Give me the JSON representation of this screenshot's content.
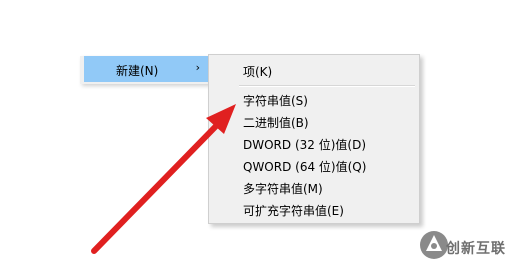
{
  "parent_menu": {
    "item_label": "新建(N)",
    "arrow": "›"
  },
  "submenu": {
    "items": [
      {
        "label": "项(K)"
      },
      {
        "label": "字符串值(S)"
      },
      {
        "label": "二进制值(B)"
      },
      {
        "label": "DWORD (32 位)值(D)"
      },
      {
        "label": "QWORD (64 位)值(Q)"
      },
      {
        "label": "多字符串值(M)"
      },
      {
        "label": "可扩充字符串值(E)"
      }
    ]
  },
  "watermark": {
    "text": "创新互联",
    "icon": "logo-icon"
  },
  "colors": {
    "highlight": "#91c9f7",
    "menu_bg": "#f0f0f0",
    "arrow": "#e02020"
  },
  "icons": [
    "submenu-arrow-icon",
    "red-pointer-arrow-icon",
    "logo-icon"
  ]
}
